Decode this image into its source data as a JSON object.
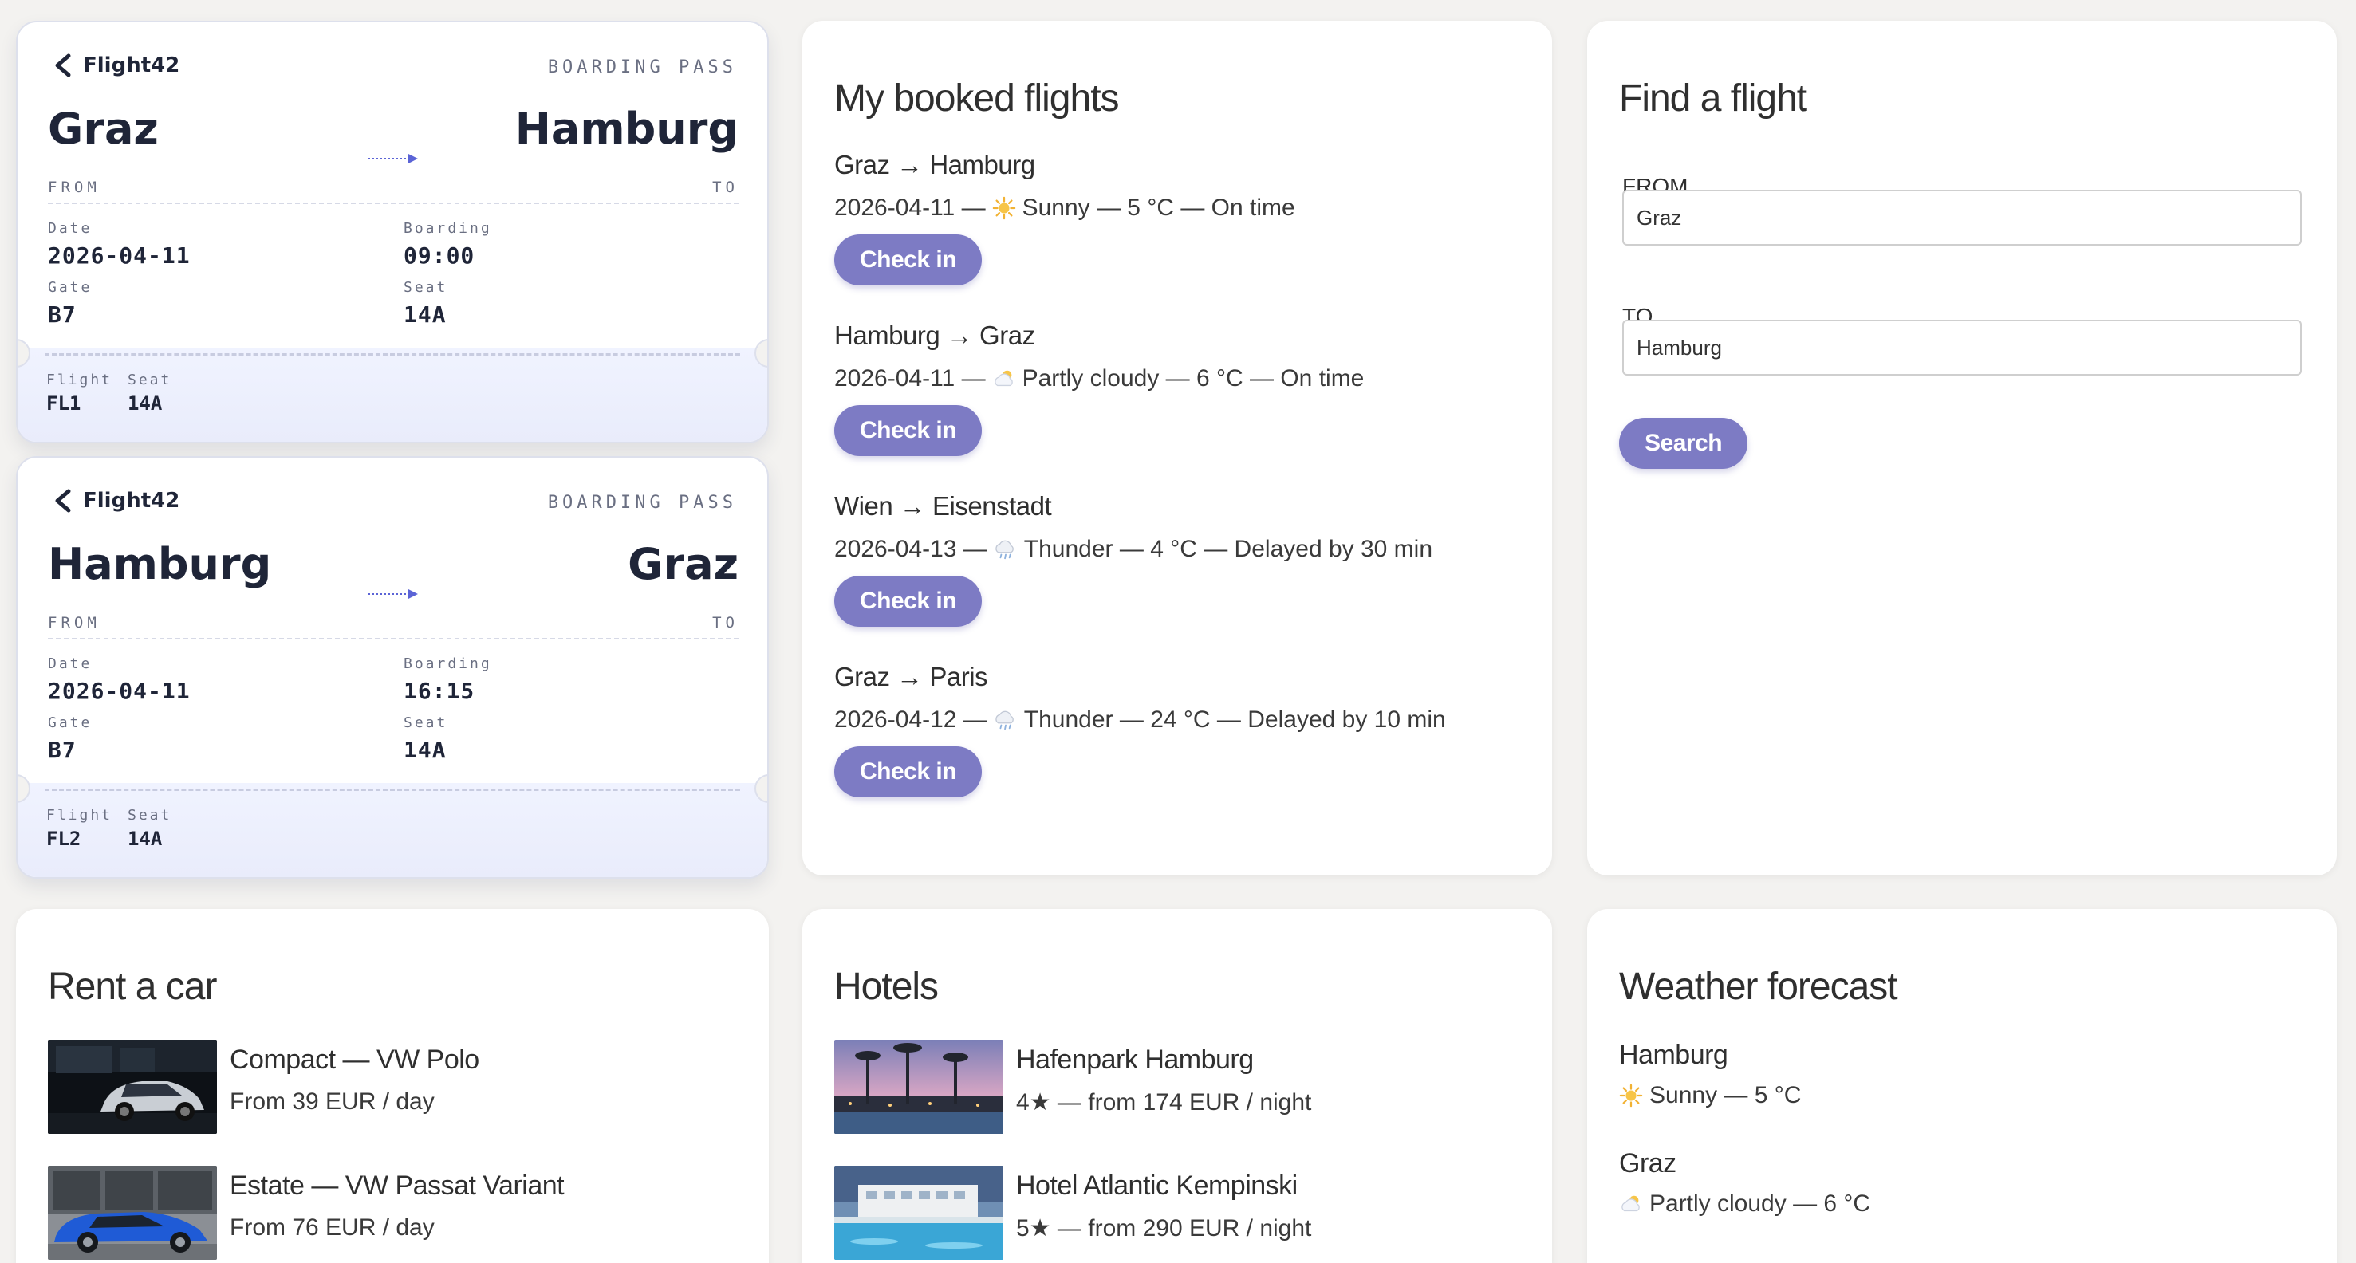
{
  "passes": [
    {
      "brand": "Flight42",
      "label": "BOARDING PASS",
      "from": "Graz",
      "to": "Hamburg",
      "from_label": "FROM",
      "to_label": "TO",
      "date_label": "Date",
      "date": "2026-04-11",
      "boarding_label": "Boarding",
      "boarding": "09:00",
      "gate_label": "Gate",
      "gate": "B7",
      "seat_label": "Seat",
      "seat": "14A",
      "flight_label": "Flight",
      "flight": "FL1"
    },
    {
      "brand": "Flight42",
      "label": "BOARDING PASS",
      "from": "Hamburg",
      "to": "Graz",
      "from_label": "FROM",
      "to_label": "TO",
      "date_label": "Date",
      "date": "2026-04-11",
      "boarding_label": "Boarding",
      "boarding": "16:15",
      "gate_label": "Gate",
      "gate": "B7",
      "seat_label": "Seat",
      "seat": "14A",
      "flight_label": "Flight",
      "flight": "FL2"
    }
  ],
  "booked": {
    "title": "My booked flights",
    "checkin_label": "Check in",
    "items": [
      {
        "route": "Graz → Hamburg",
        "date": "2026-04-11 —",
        "weather_icon": "sun-icon",
        "weather": "Sunny — 5 °C — On time"
      },
      {
        "route": "Hamburg → Graz",
        "date": "2026-04-11 —",
        "weather_icon": "partly-cloudy-icon",
        "weather": "Partly cloudy — 6 °C — On time"
      },
      {
        "route": "Wien → Eisenstadt",
        "date": "2026-04-13 —",
        "weather_icon": "thunder-icon",
        "weather": "Thunder — 4 °C — Delayed by 30 min"
      },
      {
        "route": "Graz → Paris",
        "date": "2026-04-12 —",
        "weather_icon": "thunder-icon",
        "weather": "Thunder — 24 °C — Delayed by 10 min"
      }
    ]
  },
  "find": {
    "title": "Find a flight",
    "from_label": "FROM",
    "from_value": "Graz",
    "to_label": "TO",
    "to_value": "Hamburg",
    "search_label": "Search"
  },
  "cars": {
    "title": "Rent a car",
    "items": [
      {
        "name": "Compact — VW Polo",
        "price": "From 39 EUR / day"
      },
      {
        "name": "Estate — VW Passat Variant",
        "price": "From 76 EUR / day"
      }
    ]
  },
  "hotels": {
    "title": "Hotels",
    "items": [
      {
        "name": "Hafenpark Hamburg",
        "info": "4★ — from 174 EUR / night"
      },
      {
        "name": "Hotel Atlantic Kempinski",
        "info": "5★ — from 290 EUR / night"
      }
    ]
  },
  "weather": {
    "title": "Weather forecast",
    "items": [
      {
        "city": "Hamburg",
        "icon": "sun-icon",
        "cond": "Sunny — 5 °C"
      },
      {
        "city": "Graz",
        "icon": "partly-cloudy-icon",
        "cond": "Partly cloudy — 6 °C"
      }
    ]
  },
  "colors": {
    "background": "#f3f2f0",
    "accent": "#7d7bc4",
    "pass_text": "#1f2538",
    "pass_stub": "#eef1fd"
  }
}
